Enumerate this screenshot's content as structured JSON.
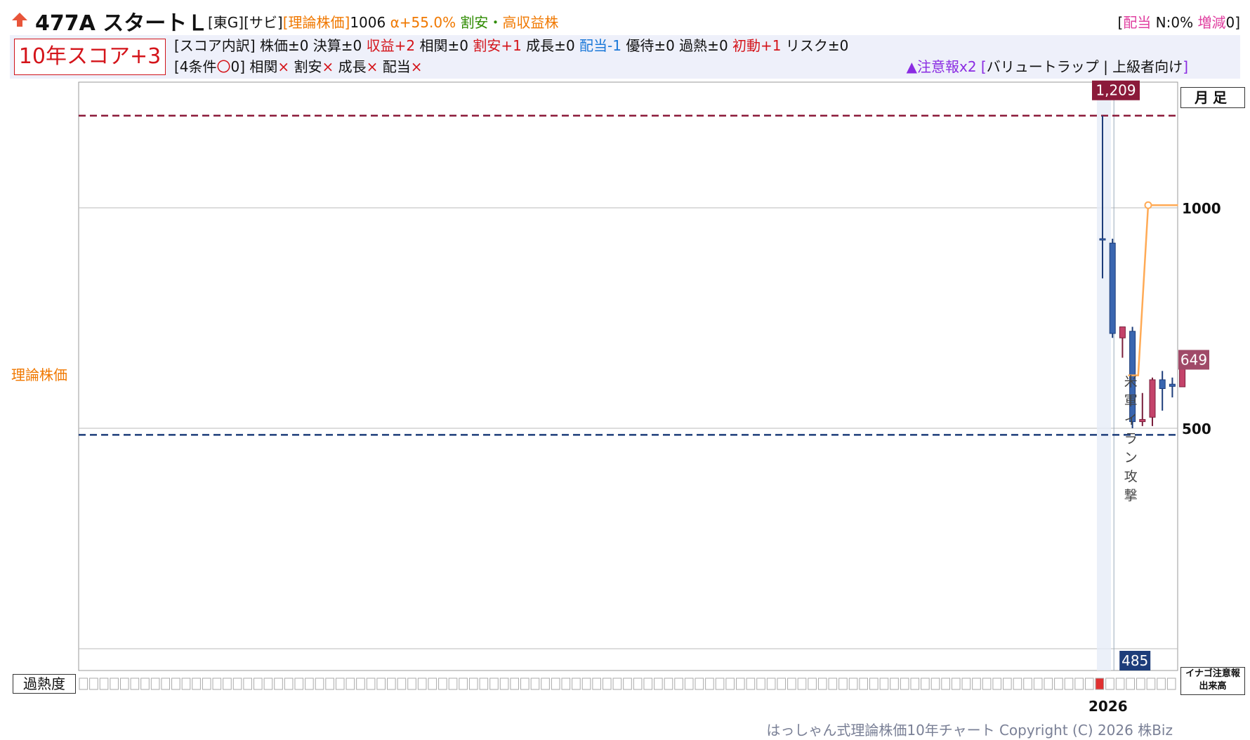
{
  "header": {
    "ticker": "477A スタートＬ",
    "market_tag": "[東G][サビ]",
    "theory_tag": "[理論株価]",
    "theory_value": "1006",
    "alpha": "α+55.0%",
    "label_cheap": "割安",
    "separator": "・",
    "label_income": "高収益株",
    "dividend_prefix": "[",
    "dividend_label": "配当",
    "dividend_value": " N:0% ",
    "change_label": "増減",
    "change_value": "0]"
  },
  "score": {
    "box": "10年スコア+3",
    "breakdown": [
      {
        "text": "[スコア内訳] 株価±0 決算±0 ",
        "color": ""
      },
      {
        "text": "収益+2",
        "color": "red"
      },
      {
        "text": " 相関±0 ",
        "color": ""
      },
      {
        "text": "割安+1",
        "color": "red"
      },
      {
        "text": " 成長±0 ",
        "color": ""
      },
      {
        "text": "配当-1",
        "color": "blue"
      },
      {
        "text": " 優待±0 過熱±0 ",
        "color": ""
      },
      {
        "text": "初動+1",
        "color": "red"
      },
      {
        "text": " リスク±0",
        "color": ""
      }
    ],
    "conditions": [
      {
        "text": "[4条件",
        "color": ""
      },
      {
        "text": "〇",
        "color": "red"
      },
      {
        "text": "0] 相関",
        "color": ""
      },
      {
        "text": "×",
        "color": "red"
      },
      {
        "text": " 割安",
        "color": ""
      },
      {
        "text": "×",
        "color": "red"
      },
      {
        "text": " 成長",
        "color": ""
      },
      {
        "text": "×",
        "color": "red"
      },
      {
        "text": " 配当",
        "color": ""
      },
      {
        "text": "×",
        "color": "red"
      }
    ],
    "warning_mark": "▲注意報x2",
    "warning_bracket_open": " [",
    "warning_text": "バリュートラップ | 上級者向け",
    "warning_bracket_close": "]"
  },
  "side": {
    "theory_label": "理論株価",
    "overheat_label": "過熱度",
    "inago_line1": "イナゴ注意報",
    "inago_line2": "出来高",
    "legend": "月足",
    "year": "2026",
    "footer": "はっしゃん式理論株価10年チャート Copyright (C) 2026 株Biz"
  },
  "chart_data": {
    "type": "candlestick",
    "period": "monthly",
    "y_ticks": [
      500,
      1000
    ],
    "high_label": "1,209",
    "low_label": "485",
    "last_label": "649",
    "high_value": 1209,
    "low_value": 485,
    "last_value": 649,
    "annotation": "米軍イラン攻撃",
    "candles": [
      {
        "open": 930,
        "high": 1209,
        "low": 840,
        "close": 930,
        "color": "blue"
      },
      {
        "open": 920,
        "high": 930,
        "low": 705,
        "close": 715,
        "color": "blue"
      },
      {
        "open": 705,
        "high": 730,
        "low": 660,
        "close": 730,
        "color": "red"
      },
      {
        "open": 720,
        "high": 730,
        "low": 500,
        "close": 515,
        "color": "blue"
      },
      {
        "open": 515,
        "high": 580,
        "low": 505,
        "close": 520,
        "color": "red"
      },
      {
        "open": 525,
        "high": 615,
        "low": 505,
        "close": 610,
        "color": "red"
      },
      {
        "open": 610,
        "high": 630,
        "low": 540,
        "close": 590,
        "color": "blue"
      },
      {
        "open": 600,
        "high": 615,
        "low": 570,
        "close": 595,
        "color": "blue"
      },
      {
        "open": 594,
        "high": 650,
        "low": 594,
        "close": 649,
        "color": "red"
      }
    ],
    "theory_price": [
      null,
      null,
      null,
      620,
      620,
      1006,
      1006,
      1006,
      1006
    ],
    "overheat_active_index": 1
  },
  "colors": {
    "bull": "#c4436a",
    "bear": "#3a66b0",
    "high_line": "#8b1a3a",
    "low_line": "#1d3d7a",
    "theory_line": "#ffaa55"
  }
}
